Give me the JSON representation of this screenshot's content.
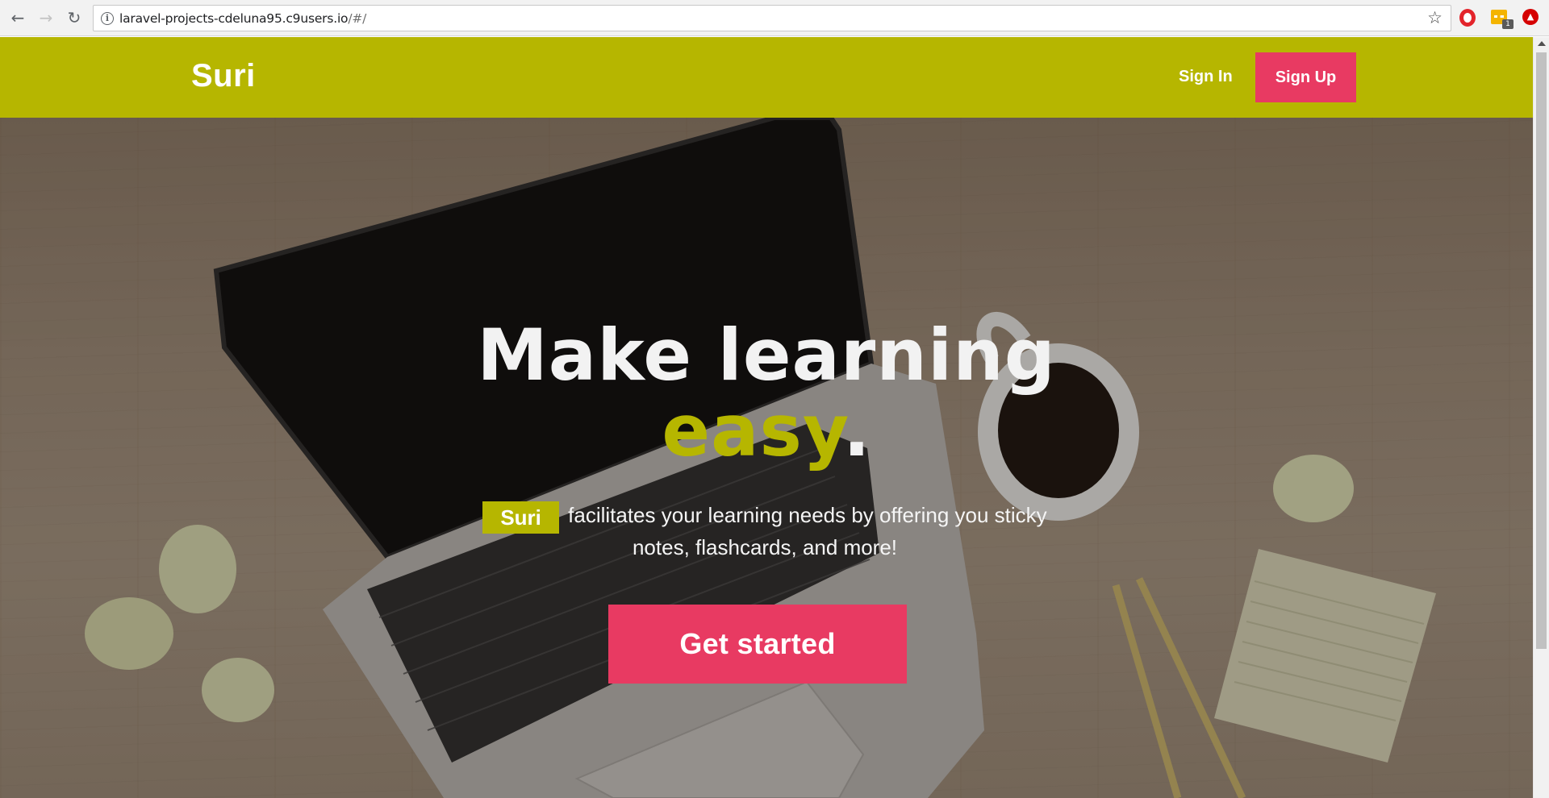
{
  "browser": {
    "url_host": "laravel-projects-cdeluna95.c9users.io",
    "url_path": "/#/",
    "back_icon": "arrow-left-icon",
    "forward_icon": "arrow-right-icon",
    "reload_icon": "reload-icon",
    "info_icon": "info-icon",
    "bookmark_icon": "star-icon",
    "extension_badge_count": "1"
  },
  "navbar": {
    "brand": "Suri",
    "sign_in": "Sign In",
    "sign_up": "Sign Up",
    "bar_color": "#b6b600",
    "button_color": "#e83a62"
  },
  "hero": {
    "headline_line1": "Make learning",
    "headline_accent": "easy",
    "headline_period": ".",
    "brand_pill": "Suri",
    "tagline": "facilitates your learning needs by offering you sticky notes, flashcards, and more!",
    "cta": "Get started",
    "background_image": "laptop-on-wooden-desk-with-coffee-cup"
  }
}
